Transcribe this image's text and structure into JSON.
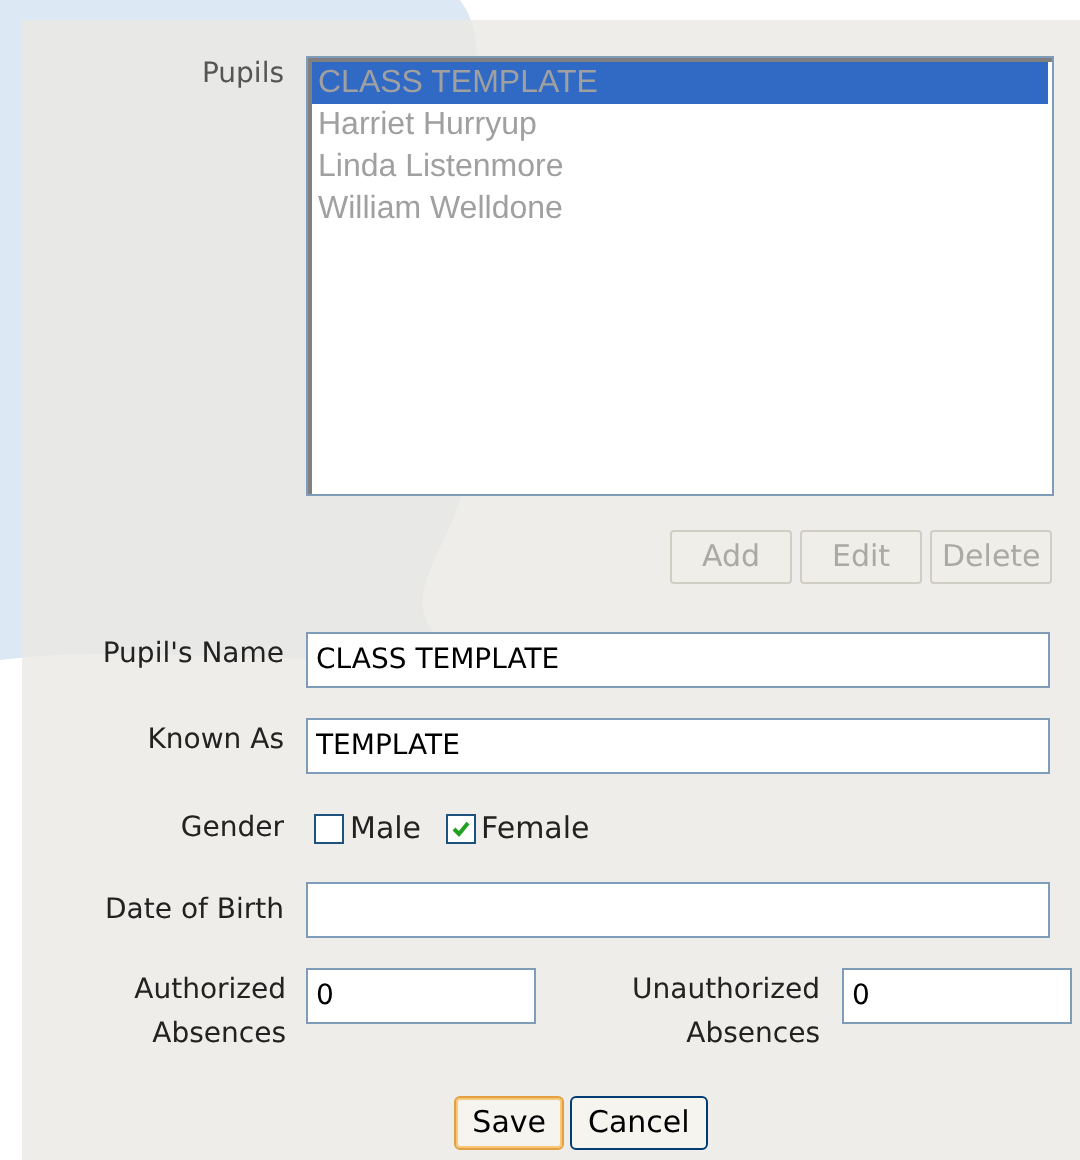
{
  "pupils": {
    "label": "Pupils",
    "disabled": true,
    "items": [
      {
        "text": "CLASS TEMPLATE",
        "selected": true
      },
      {
        "text": "Harriet Hurryup",
        "selected": false
      },
      {
        "text": "Linda Listenmore",
        "selected": false
      },
      {
        "text": "William Welldone",
        "selected": false
      }
    ]
  },
  "list_buttons": [
    {
      "label": "Add",
      "disabled": true
    },
    {
      "label": "Edit",
      "disabled": true
    },
    {
      "label": "Delete",
      "disabled": true
    }
  ],
  "pupil_name": {
    "label": "Pupil's Name",
    "value": "CLASS TEMPLATE"
  },
  "known_as": {
    "label": "Known As",
    "value": "TEMPLATE"
  },
  "gender": {
    "label": "Gender",
    "options": [
      {
        "label": "Male",
        "checked": false
      },
      {
        "label": "Female",
        "checked": true
      }
    ]
  },
  "date_of_birth": {
    "label": "Date of Birth"
  },
  "authorized_absences": {
    "label": "Authorized Absences",
    "value": "0"
  },
  "unauthorized_absences": {
    "label": "Unauthorized Absences",
    "value": "0"
  },
  "actions": [
    {
      "label": "Save",
      "default": true
    },
    {
      "label": "Cancel",
      "default": false
    }
  ]
}
